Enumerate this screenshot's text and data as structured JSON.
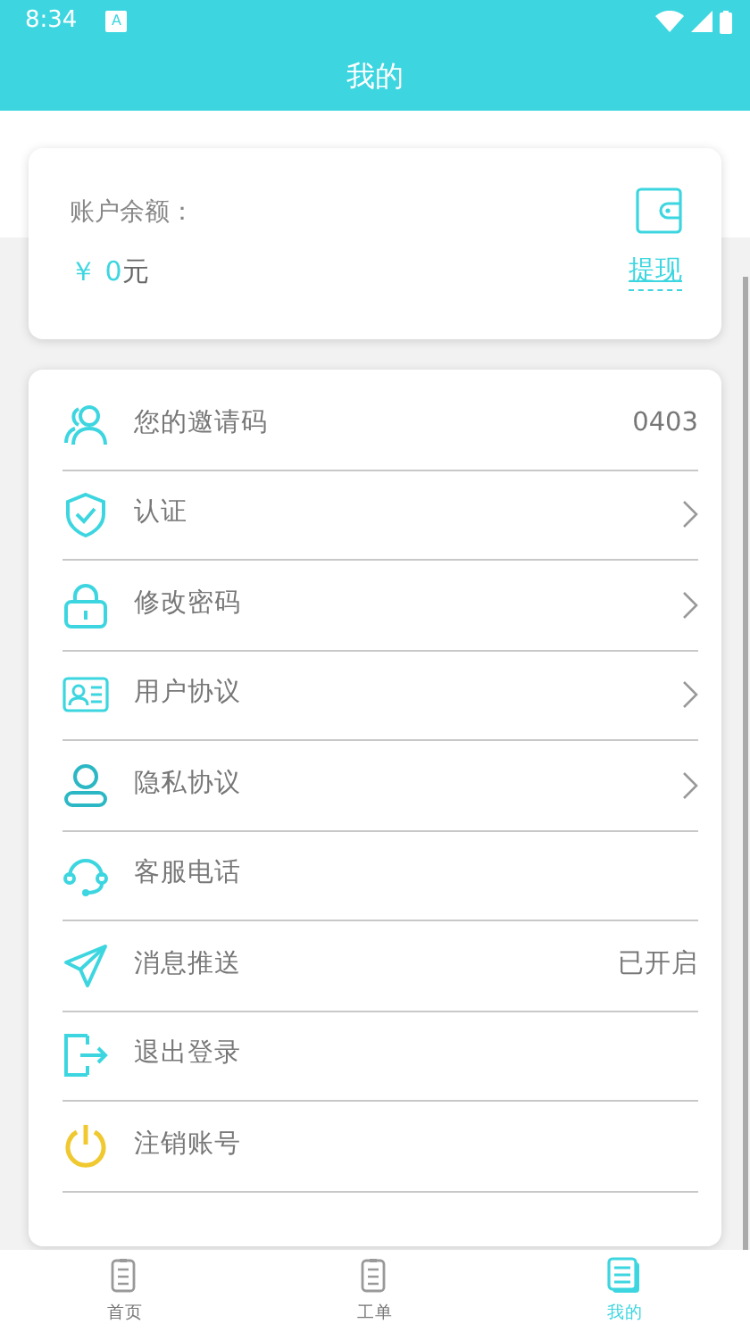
{
  "status_bar": {
    "time": "8:34",
    "notification_icon": "A"
  },
  "header": {
    "title": "我的"
  },
  "balance_card": {
    "label": "账户余额：",
    "currency": "￥",
    "amount": "0",
    "unit": "元",
    "withdraw": "提现"
  },
  "menu": [
    {
      "kind": "value",
      "label": "您的邀请码",
      "value": "0403"
    },
    {
      "kind": "link",
      "label": "认证"
    },
    {
      "kind": "link",
      "label": "修改密码"
    },
    {
      "kind": "link",
      "label": "用户协议"
    },
    {
      "kind": "link",
      "label": "隐私协议"
    },
    {
      "kind": "plain",
      "label": "客服电话"
    },
    {
      "kind": "value",
      "label": "消息推送",
      "value": "已开启"
    },
    {
      "kind": "plain",
      "label": "退出登录"
    },
    {
      "kind": "plain",
      "label": "注销账号"
    }
  ],
  "bottom_nav": [
    {
      "label": "首页",
      "selected": false
    },
    {
      "label": "工单",
      "selected": false
    },
    {
      "label": "我的",
      "selected": true
    }
  ]
}
